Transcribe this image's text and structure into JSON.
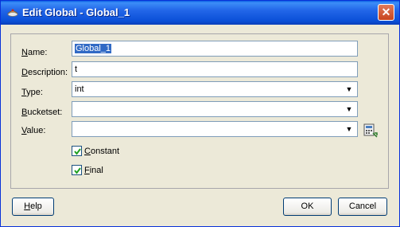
{
  "window": {
    "title": "Edit Global - Global_1",
    "close_label": "✕"
  },
  "form": {
    "name_label_u": "N",
    "name_label_rest": "ame:",
    "name_value": "Global_1",
    "description_label_u": "D",
    "description_label_rest": "escription:",
    "description_value": "t",
    "type_label_u": "T",
    "type_label_rest": "ype:",
    "type_value": "int",
    "bucketset_label_u": "B",
    "bucketset_label_rest": "ucketset:",
    "bucketset_value": "",
    "value_label_u": "V",
    "value_label_rest": "alue:",
    "value_value": "",
    "constant_label_u": "C",
    "constant_label_rest": "onstant",
    "constant_checked": true,
    "final_label_u": "F",
    "final_label_rest": "inal",
    "final_checked": true
  },
  "buttons": {
    "help_u": "H",
    "help_rest": "elp",
    "ok": "OK",
    "cancel": "Cancel"
  }
}
